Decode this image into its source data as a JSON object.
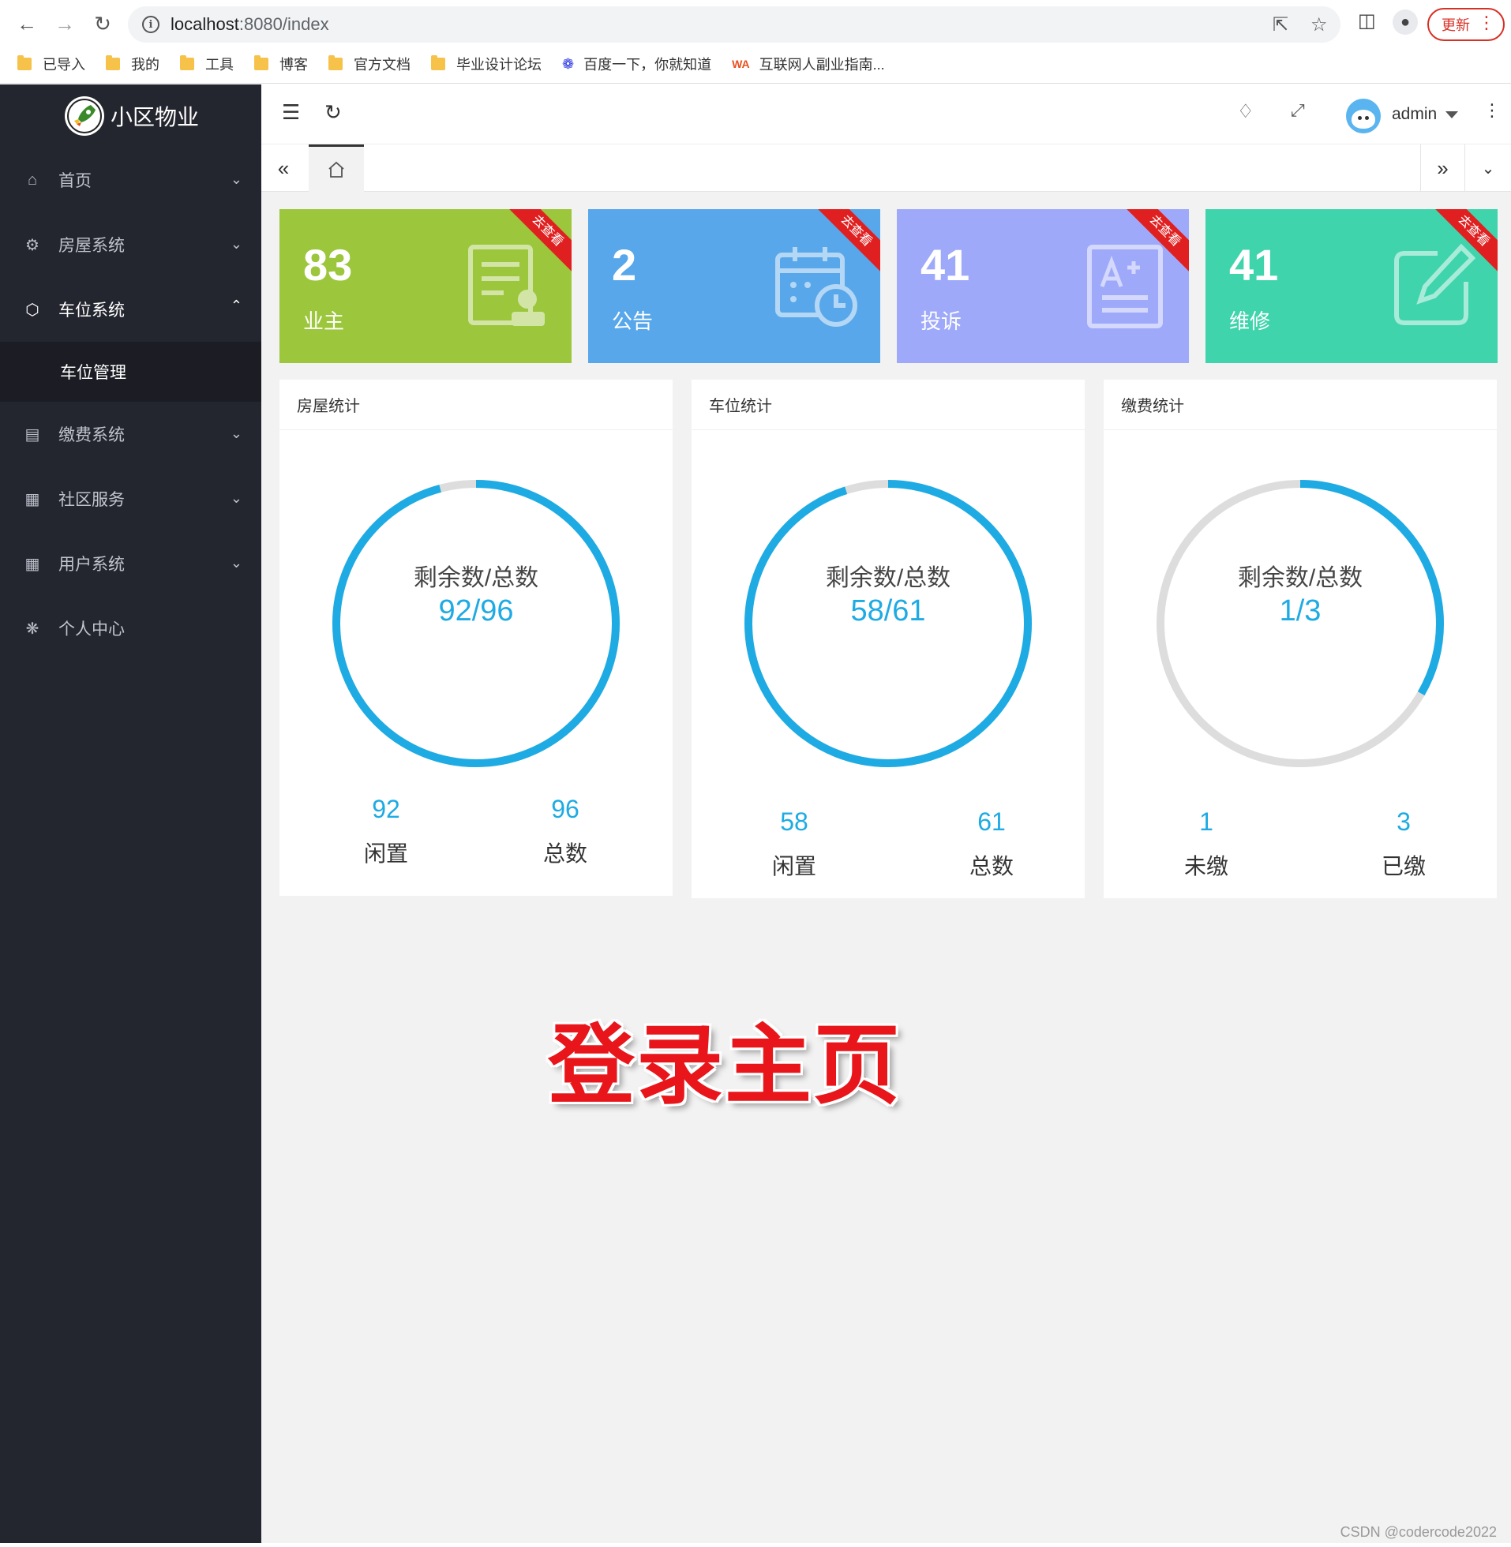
{
  "browser": {
    "url_host": "localhost",
    "url_path": ":8080/index",
    "update_label": "更新",
    "bookmarks": [
      "已导入",
      "我的",
      "工具",
      "博客",
      "官方文档",
      "毕业设计论坛",
      "百度一下，你就知道",
      "互联网人副业指南..."
    ]
  },
  "sidebar": {
    "app_title": "小区物业",
    "items": [
      {
        "label": "首页",
        "icon": "home-icon"
      },
      {
        "label": "房屋系统",
        "icon": "gear-icon"
      },
      {
        "label": "车位系统",
        "icon": "cube-icon"
      },
      {
        "label": "缴费系统",
        "icon": "ledger-icon"
      },
      {
        "label": "社区服务",
        "icon": "grid-icon"
      },
      {
        "label": "用户系统",
        "icon": "grid-icon"
      },
      {
        "label": "个人中心",
        "icon": "settings-icon"
      }
    ],
    "submenu": {
      "label": "车位管理"
    }
  },
  "header": {
    "username": "admin"
  },
  "stat_cards": [
    {
      "value": "83",
      "label": "业主",
      "ribbon": "去查看",
      "color": "#9cc63b"
    },
    {
      "value": "2",
      "label": "公告",
      "ribbon": "去查看",
      "color": "#58a7ea"
    },
    {
      "value": "41",
      "label": "投诉",
      "ribbon": "去查看",
      "color": "#9ea9fa"
    },
    {
      "value": "41",
      "label": "维修",
      "ribbon": "去查看",
      "color": "#3fd4ac"
    }
  ],
  "panels": [
    {
      "title": "房屋统计",
      "ring_label": "剩余数/总数",
      "ring_value": "92/96",
      "remaining": 92,
      "total": 96,
      "foot_left_value": "92",
      "foot_left_label": "闲置",
      "foot_right_value": "96",
      "foot_right_label": "总数"
    },
    {
      "title": "车位统计",
      "ring_label": "剩余数/总数",
      "ring_value": "58/61",
      "remaining": 58,
      "total": 61,
      "foot_left_value": "58",
      "foot_left_label": "闲置",
      "foot_right_value": "61",
      "foot_right_label": "总数"
    },
    {
      "title": "缴费统计",
      "ring_label": "剩余数/总数",
      "ring_value": "1/3",
      "remaining": 1,
      "total": 3,
      "foot_left_value": "1",
      "foot_left_label": "未缴",
      "foot_right_value": "3",
      "foot_right_label": "已缴"
    }
  ],
  "colors": {
    "ring": "#1eabe3",
    "ring_track": "#dddddd",
    "sidebar_bg": "#24262f"
  },
  "overlay_title": "登录主页",
  "credit": "CSDN @codercode2022"
}
